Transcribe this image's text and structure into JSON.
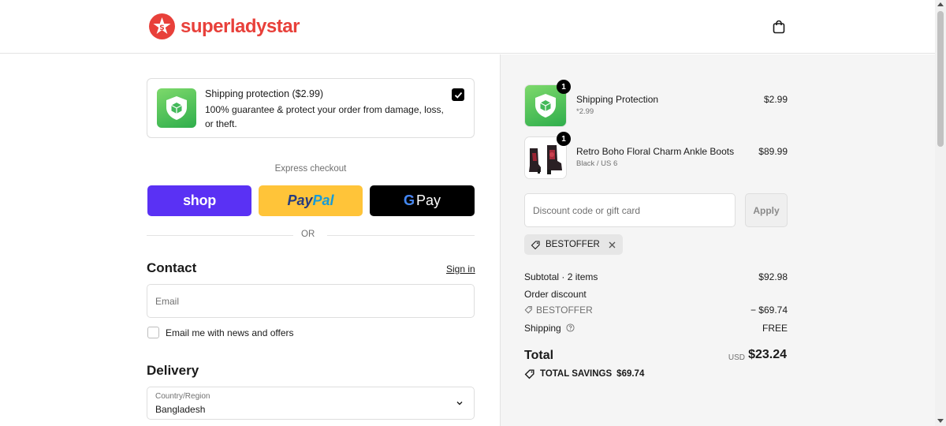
{
  "brand": {
    "name": "superladystar",
    "accent": "#e8403a"
  },
  "header": {
    "cart_icon": "shopping-bag-icon"
  },
  "protection_offer": {
    "title": "Shipping protection ($2.99)",
    "description": "100% guarantee & protect your order from damage, loss, or theft.",
    "checked": true
  },
  "express": {
    "label": "Express checkout",
    "shop_label": "shop",
    "paypal_label_1": "Pay",
    "paypal_label_2": "Pal",
    "gpay_g": "G",
    "gpay_label": "Pay",
    "or_label": "OR"
  },
  "contact": {
    "title": "Contact",
    "signin_label": "Sign in",
    "email_placeholder": "Email",
    "newsletter_label": "Email me with news and offers"
  },
  "delivery": {
    "title": "Delivery",
    "country_caption": "Country/Region",
    "country_value": "Bangladesh"
  },
  "order": {
    "items": [
      {
        "qty": "1",
        "name": "Shipping Protection",
        "variant": "*2.99",
        "price": "$2.99"
      },
      {
        "qty": "1",
        "name": "Retro Boho Floral Charm Ankle Boots",
        "variant": "Black / US 6",
        "price": "$89.99"
      }
    ],
    "discount_placeholder": "Discount code or gift card",
    "apply_label": "Apply",
    "applied_code": "BESTOFFER",
    "subtotal_label": "Subtotal · 2 items",
    "subtotal_value": "$92.98",
    "order_discount_label": "Order discount",
    "discount_code_label": "BESTOFFER",
    "discount_value": "− $69.74",
    "shipping_label": "Shipping",
    "shipping_value": "FREE",
    "total_label": "Total",
    "total_currency": "USD",
    "total_value": "$23.24",
    "savings_label": "TOTAL SAVINGS",
    "savings_value": "$69.74"
  }
}
